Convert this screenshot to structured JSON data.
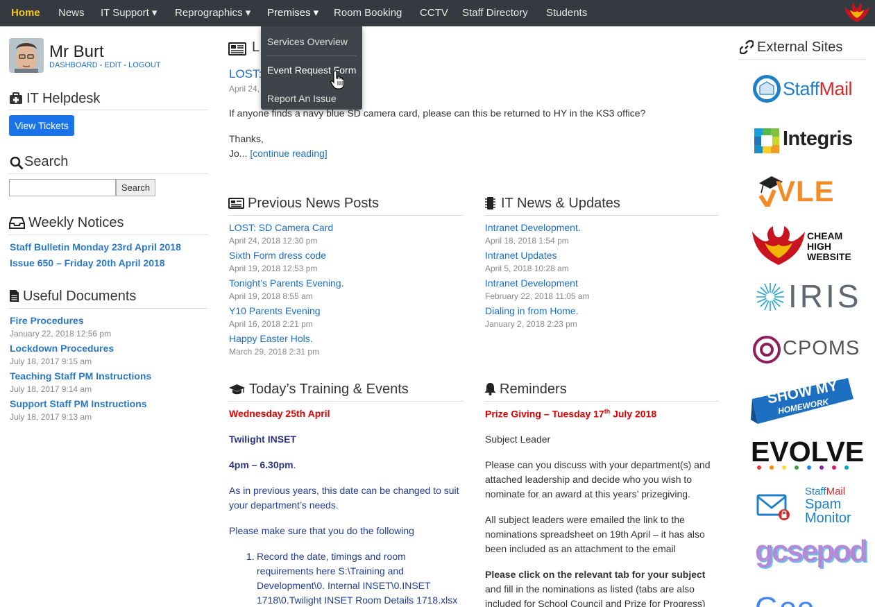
{
  "nav": {
    "items": [
      {
        "label": "Home",
        "active": true
      },
      {
        "label": "News"
      },
      {
        "label": "IT Support ▾"
      },
      {
        "label": "Reprographics ▾"
      },
      {
        "label": "Premises ▾"
      },
      {
        "label": "Room Booking"
      },
      {
        "label": "CCTV"
      },
      {
        "label": "Staff Directory"
      },
      {
        "label": "Students"
      }
    ],
    "accent": "#f5c518",
    "background": "#343a40"
  },
  "dropdown": {
    "items": [
      "Services Overview",
      "Event Request Form",
      "Report An Issue"
    ]
  },
  "user": {
    "name": "Mr Burt",
    "dashboard": "DASHBOARD",
    "edit": "EDIT",
    "logout": "LOGOUT",
    "sep": "-"
  },
  "helpdesk": {
    "title": "IT Helpdesk",
    "button": "View Tickets"
  },
  "search": {
    "title": "Search",
    "button": "Search",
    "value": ""
  },
  "weekly": {
    "title": "Weekly Notices",
    "items": [
      "Staff Bulletin Monday 23rd April 2018",
      "Issue 650 – Friday 20th April 2018"
    ]
  },
  "documents": {
    "title": "Useful Documents",
    "items": [
      {
        "title": "Fire Procedures",
        "date": "January 22, 2018 12:56 pm"
      },
      {
        "title": "Lockdown Procedures",
        "date": "July 18, 2017 9:15 am"
      },
      {
        "title": "Teaching Staff PM Instructions",
        "date": "July 18, 2017 9:14 am"
      },
      {
        "title": "Support Staff PM Instructions",
        "date": "July 18, 2017 9:13 am"
      }
    ]
  },
  "latest": {
    "title_visible": "L",
    "post_title_visible": "LOST:",
    "post_date_visible": "April 24,",
    "text_line": "If anyone finds a navy blue SD camera card, please can this be returned to HY in the KS3 office?",
    "thanks": "Thanks,",
    "jo": "Jo...",
    "continue": "[continue reading]"
  },
  "previous": {
    "title": "Previous News Posts",
    "items": [
      {
        "title": "LOST: SD Camera Card",
        "date": "April 24, 2018 12:30 pm"
      },
      {
        "title": "Sixth Form dress code",
        "date": "April 19, 2018 12:53 pm"
      },
      {
        "title": "Tonight’s Parents Evening.",
        "date": "April 19, 2018 8:55 am"
      },
      {
        "title": "Y10 Parents Evening",
        "date": "April 16, 2018 2:21 pm"
      },
      {
        "title": "Happy Easter Hols.",
        "date": "March 29, 2018 2:31 pm"
      }
    ]
  },
  "itnews": {
    "title": "IT News & Updates",
    "items": [
      {
        "title": "Intranet Development.",
        "date": "April 18, 2018 1:54 pm"
      },
      {
        "title": "Intranet Updates",
        "date": "April 5, 2018 10:28 am"
      },
      {
        "title": "Intranet Development",
        "date": "February 22, 2018 11:05 am"
      },
      {
        "title": "Dialing in from Home.",
        "date": "January 2, 2018 2:23 pm"
      }
    ]
  },
  "training": {
    "title": "Today’s Training & Events",
    "date_line": "Wednesday 25th April",
    "inset": "Twilight INSET",
    "time": "4pm – 6.30pm",
    "time_dot": ".",
    "para1_l1": "As in previous years, this date can be changed to suit",
    "para1_l2": "your department’s needs.",
    "para2": "Please make sure that you do the following",
    "list_num": "1.",
    "list_l1": "Record the date, timings and room",
    "list_l2": "requirements here S:\\Training and",
    "list_l3": "Development\\0. Internal INSET\\0.INSET",
    "list_l4": "1718\\0.Twilight INSET Room Details 1718.xlsx"
  },
  "reminders": {
    "title": "Reminders",
    "heading_pre": "Prize Giving – Tuesday 17",
    "heading_sup": "th",
    "heading_post": " July 2018",
    "subject_leader": "Subject Leader",
    "p1_l1": "Please can you discuss with your department(s) and",
    "p1_l2": "attached leadership and decide who you wish to",
    "p1_l3": "nominate for an award at this years’ prizegiving.",
    "p2_l1": "All subject leaders were emailed the link to the",
    "p2_l2": "nominations spreadsheet on 19th April – it has also",
    "p2_l3": "been included as an attachment to the email",
    "p3_l1": "Please click on the relevant tab for your subject",
    "p3_l2": "and fill in the nominations as listed (tabs are also",
    "p3_l3": "included for School Council and Prize for Progress)"
  },
  "external": {
    "title": "External Sites",
    "staffmail_a": "Staff",
    "staffmail_b": "Mail",
    "integris": "Integris",
    "vle": "VLE",
    "cheam_l1": "CHEAM",
    "cheam_l2": "HIGH",
    "cheam_l3": "WEBSITE",
    "iris": "IRIS",
    "cpoms": "CPOMS",
    "smh_l1": "SHOW MY",
    "smh_l2": "HOMEWORK",
    "evolve": "EVOLVE",
    "spam_l1a": "Staff",
    "spam_l1b": "Mail",
    "spam_l2": "Spam",
    "spam_l3": "Monitor",
    "gcsepod": "gcsepod",
    "google": "Goo"
  }
}
